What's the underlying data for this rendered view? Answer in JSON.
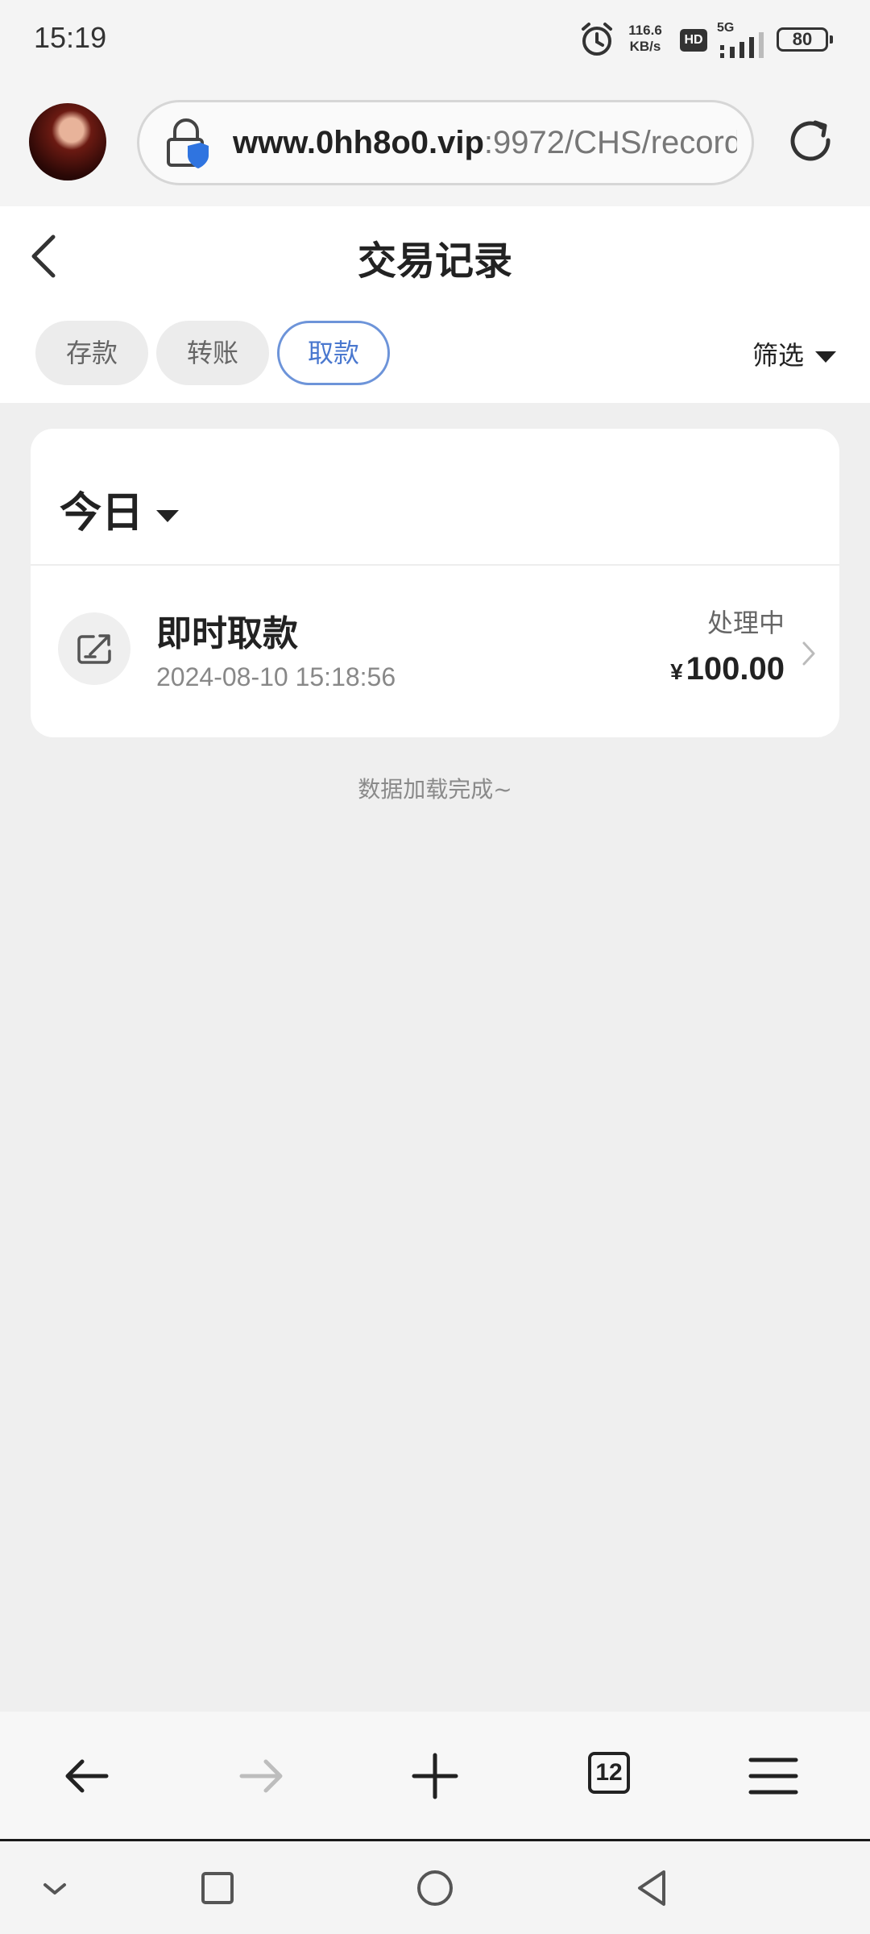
{
  "status_bar": {
    "time": "15:19",
    "net_speed_value": "116.6",
    "net_speed_unit": "KB/s",
    "hd_badge": "HD",
    "network": "5G",
    "battery": "80"
  },
  "browser": {
    "url_host": "www.0hh8o0.vip",
    "url_rest": ":9972/CHS/record",
    "tab_count": "12"
  },
  "page": {
    "title": "交易记录",
    "tabs": [
      {
        "label": "存款",
        "active": false
      },
      {
        "label": "转账",
        "active": false
      },
      {
        "label": "取款",
        "active": true
      }
    ],
    "filter_label": "筛选"
  },
  "records": {
    "period_label": "今日",
    "items": [
      {
        "title": "即时取款",
        "datetime": "2024-08-10 15:18:56",
        "status": "处理中",
        "currency": "¥",
        "amount": "100.00",
        "icon": "withdraw-icon"
      }
    ],
    "footer": "数据加载完成~"
  },
  "colors": {
    "accent": "#4a78cf",
    "background": "#efefef",
    "card": "#ffffff"
  }
}
